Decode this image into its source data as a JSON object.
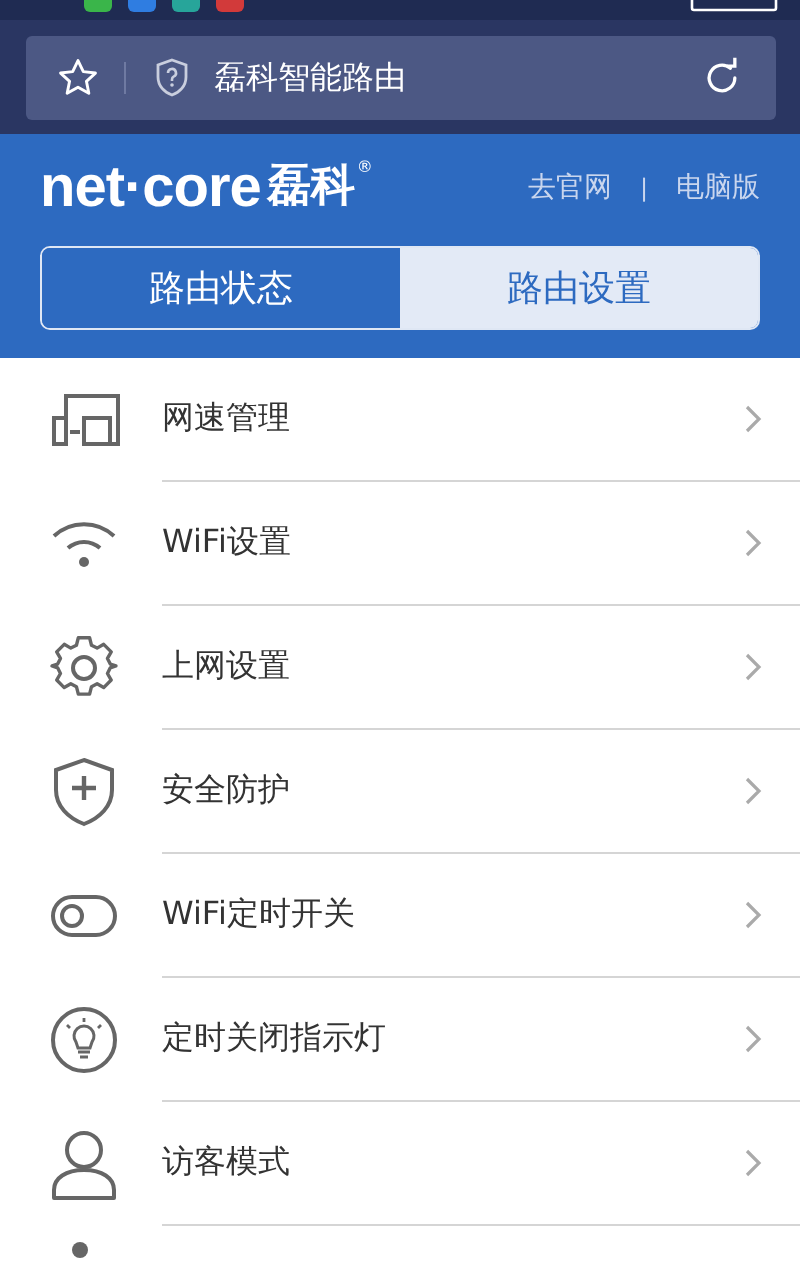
{
  "browser": {
    "title": "磊科智能路由"
  },
  "header": {
    "logo_latin": "net·core",
    "logo_chinese": "磊科",
    "logo_mark": "®",
    "links": [
      "去官网",
      "电脑版"
    ],
    "separator": "|"
  },
  "tabs": [
    {
      "label": "路由状态",
      "selected": false
    },
    {
      "label": "路由设置",
      "selected": true
    }
  ],
  "menu": [
    {
      "kind": "speed",
      "label": "网速管理"
    },
    {
      "kind": "wifi",
      "label": "WiFi设置"
    },
    {
      "kind": "gear",
      "label": "上网设置"
    },
    {
      "kind": "shield",
      "label": "安全防护"
    },
    {
      "kind": "toggle",
      "label": "WiFi定时开关"
    },
    {
      "kind": "bulb",
      "label": "定时关闭指示灯"
    },
    {
      "kind": "person",
      "label": "访客模式"
    },
    {
      "kind": "dot"
    }
  ]
}
